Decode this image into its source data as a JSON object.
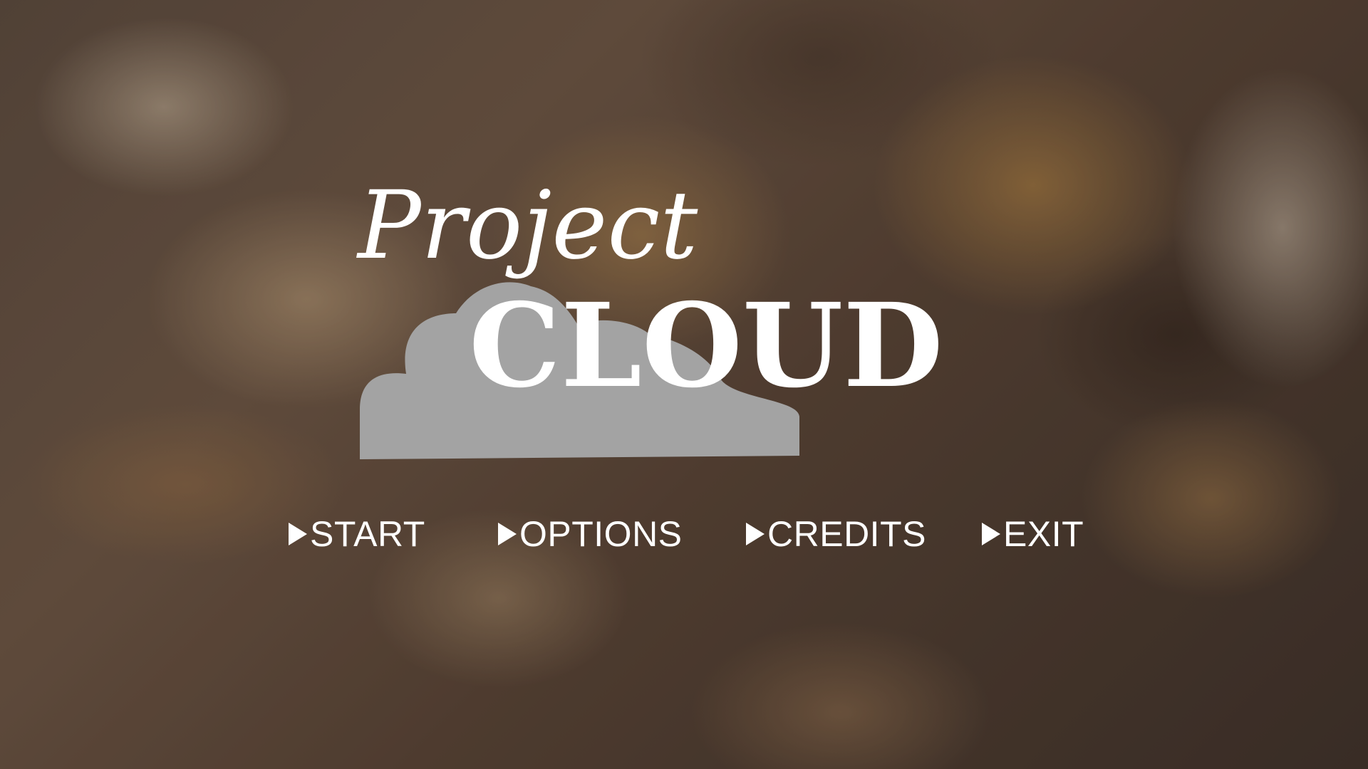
{
  "title": {
    "line1": "Project",
    "line2": "CLOUD"
  },
  "menu": {
    "items": [
      {
        "label": "START",
        "icon": "play-triangle-icon"
      },
      {
        "label": "OPTIONS",
        "icon": "play-triangle-icon"
      },
      {
        "label": "CREDITS",
        "icon": "play-triangle-icon"
      },
      {
        "label": "EXIT",
        "icon": "play-triangle-icon"
      }
    ]
  },
  "colors": {
    "text": "#ffffff",
    "logo_cloud": "#a3a3a3",
    "background": "#5a4a3e"
  }
}
